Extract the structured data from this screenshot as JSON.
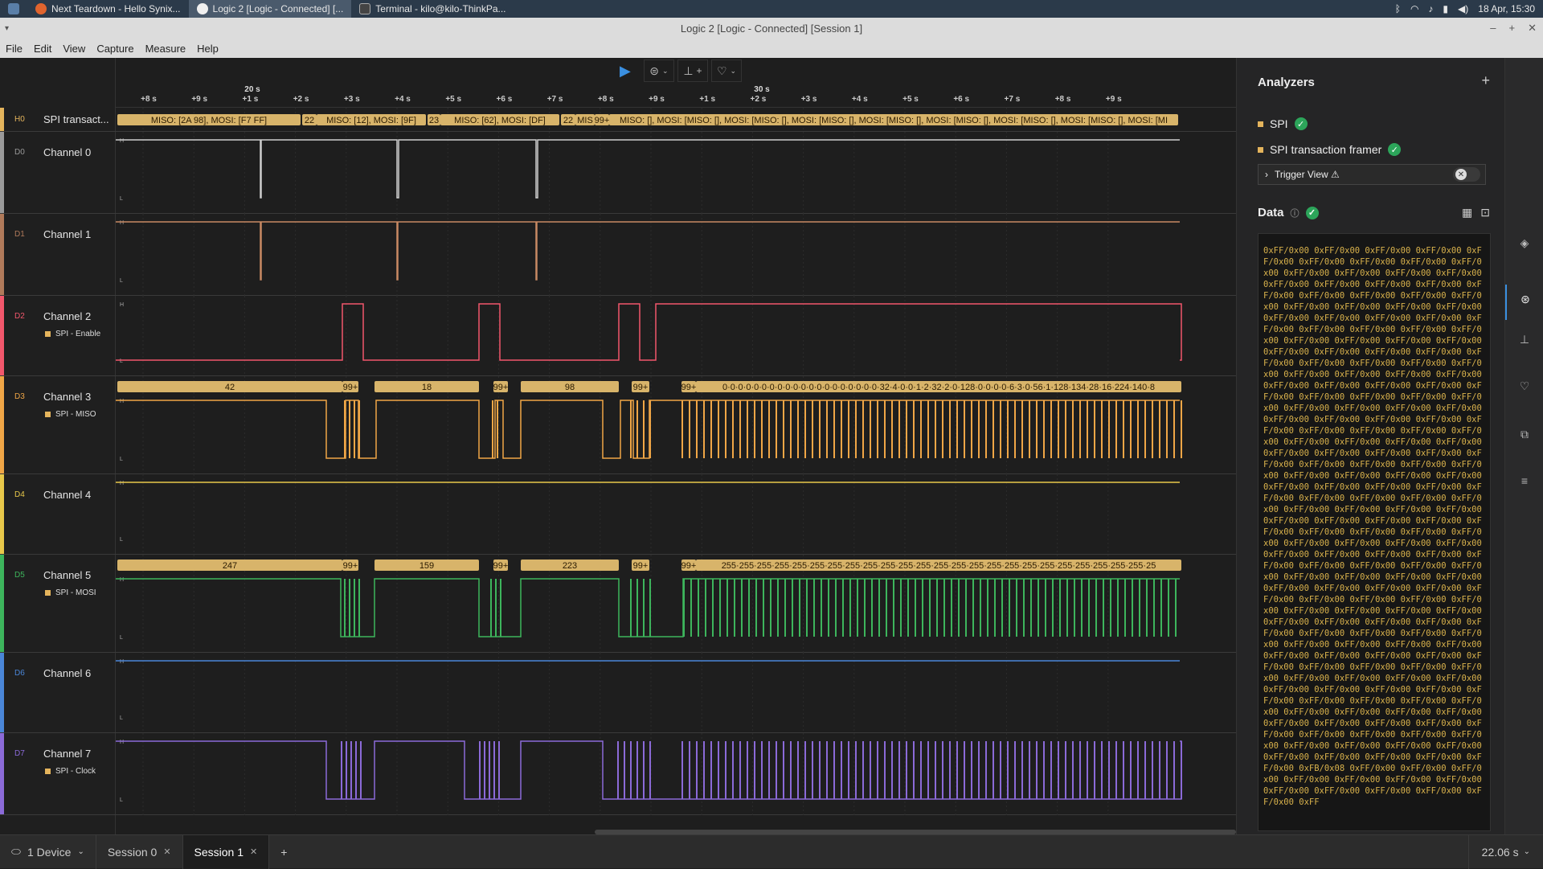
{
  "taskbar": {
    "tasks": [
      {
        "label": "Next Teardown - Hello Synix...",
        "color": "#e0642e"
      },
      {
        "label": "Logic 2 [Logic - Connected] [...",
        "color": "#f0f0f0"
      },
      {
        "label": "Terminal - kilo@kilo-ThinkPa...",
        "color": "#444444"
      }
    ],
    "clock": "18 Apr, 15:30"
  },
  "window": {
    "title": "Logic 2 [Logic - Connected] [Session 1]"
  },
  "menu": [
    "File",
    "Edit",
    "View",
    "Capture",
    "Measure",
    "Help"
  ],
  "ruler": {
    "ticks": [
      "+8 s",
      "+9 s",
      "+1 s",
      "+2 s",
      "+3 s",
      "+4 s",
      "+5 s",
      "+6 s",
      "+7 s",
      "+8 s",
      "+9 s",
      "+1 s",
      "+2 s",
      "+3 s",
      "+4 s",
      "+5 s",
      "+6 s",
      "+7 s",
      "+8 s",
      "+9 s"
    ],
    "majors": [
      "20 s",
      "30 s"
    ]
  },
  "channels": [
    {
      "id": "H0",
      "name": "SPI transact...",
      "color": "#e4b45c",
      "sub": ""
    },
    {
      "id": "D0",
      "name": "Channel 0",
      "color": "#9a9a9a",
      "sub": ""
    },
    {
      "id": "D1",
      "name": "Channel 1",
      "color": "#b07a5a",
      "sub": ""
    },
    {
      "id": "D2",
      "name": "Channel 2",
      "color": "#f2576c",
      "sub": "SPI - Enable"
    },
    {
      "id": "D3",
      "name": "Channel 3",
      "color": "#f0a646",
      "sub": "SPI - MISO"
    },
    {
      "id": "D4",
      "name": "Channel 4",
      "color": "#e8c84a",
      "sub": ""
    },
    {
      "id": "D5",
      "name": "Channel 5",
      "color": "#3db55c",
      "sub": "SPI - MOSI"
    },
    {
      "id": "D6",
      "name": "Channel 6",
      "color": "#4a86d8",
      "sub": ""
    },
    {
      "id": "D7",
      "name": "Channel 7",
      "color": "#8b6ad8",
      "sub": "SPI - Clock"
    }
  ],
  "transactions": [
    "MISO: [2A 98], MOSI: [F7 FF]",
    "22",
    "MISO: [12], MOSI: [9F]",
    "23",
    "MISO: [62], MOSI: [DF]",
    "22",
    "MIS",
    "99+",
    "MISO: [], MOSI: [MISO: [], MOSI: [MISO: [], MOSI: [MISO: [], MOSI: [MISO: [], MOSI: [MISO: [], MOSI: [MISO: [], MOSI: [MISO: [], MOSI: [MI"
  ],
  "miso_labels": [
    "42",
    "99+",
    "18",
    "99+",
    "98",
    "99+",
    "99+",
    "0·0·0·0·0·0·0·0·0·0·0·0·0·0·0·0·0·0·0·0·32·4·0·0·1·2·32·2·0·128·0·0·0·0·6·3·0·56·1·128·134·28·16·224·140·8"
  ],
  "mosi_labels": [
    "247",
    "99+",
    "159",
    "99+",
    "223",
    "99+",
    "99+",
    "255·255·255·255·255·255·255·255·255·255·255·255·255·255·255·255·255·255·255·255·255·255·255·255·25"
  ],
  "analyzers": {
    "title": "Analyzers",
    "items": [
      "SPI",
      "SPI transaction framer"
    ],
    "trigger_view": "Trigger View ⚠"
  },
  "data_panel": {
    "title": "Data",
    "terminal_text": "0xFF/0x00 0xFF/0x00 0xFF/0x00 0xFF/0x00 0xFF/0x00 0xFF/0x00 0xFF/0x00 0xFF/0x00 0xFF/0x00 0xFF/0x00 0xFF/0x00 0xFF/0x00 0xFF/0x00 0xFF/0x00 0xFF/0x00 0xFF/0x00 0xFF/0x00 0xFF/0x00 0xFF/0x00 0xFF/0x00 0xFF/0x00 0xFF/0x00 0xFF/0x00 0xFF/0x00 0xFF/0x00 0xFF/0x00 0xFF/0x00 0xFF/0x00 0xFF/0x00 0xFF/0x00 0xFF/0x00 0xFF/0x00 0xFF/0x00 0xFF/0x00 0xFF/0x00 0xFF/0x00 0xFF/0x00 0xFF/0x00 0xFF/0x00 0xFF/0x00 0xFF/0x00 0xFF/0x00 0xFF/0x00 0xFF/0x00 0xFF/0x00 0xFF/0x00 0xFF/0x00 0xFF/0x00 0xFF/0x00 0xFF/0x00 0xFF/0x00 0xFF/0x00 0xFF/0x00 0xFF/0x00 0xFF/0x00 0xFF/0x00 0xFF/0x00 0xFF/0x00 0xFF/0x00 0xFF/0x00 0xFF/0x00 0xFF/0x00 0xFF/0x00 0xFF/0x00 0xFF/0x00 0xFF/0x00 0xFF/0x00 0xFF/0x00 0xFF/0x00 0xFF/0x00 0xFF/0x00 0xFF/0x00 0xFF/0x00 0xFF/0x00 0xFF/0x00 0xFF/0x00 0xFF/0x00 0xFF/0x00 0xFF/0x00 0xFF/0x00 0xFF/0x00 0xFF/0x00 0xFF/0x00 0xFF/0x00 0xFF/0x00 0xFF/0x00 0xFF/0x00 0xFF/0x00 0xFF/0x00 0xFF/0x00 0xFF/0x00 0xFF/0x00 0xFF/0x00 0xFF/0x00 0xFF/0x00 0xFF/0x00 0xFF/0x00 0xFF/0x00 0xFF/0x00 0xFF/0x00 0xFF/0x00 0xFF/0x00 0xFF/0x00 0xFF/0x00 0xFF/0x00 0xFF/0x00 0xFF/0x00 0xFF/0x00 0xFF/0x00 0xFF/0x00 0xFF/0x00 0xFF/0x00 0xFF/0x00 0xFF/0x00 0xFF/0x00 0xFF/0x00 0xFF/0x00 0xFF/0x00 0xFF/0x00 0xFF/0x00 0xFF/0x00 0xFF/0x00 0xFF/0x00 0xFF/0x00 0xFF/0x00 0xFF/0x00 0xFF/0x00 0xFF/0x00 0xFF/0x00 0xFF/0x00 0xFF/0x00 0xFF/0x00 0xFF/0x00 0xFF/0x00 0xFF/0x00 0xFF/0x00 0xFF/0x00 0xFF/0x00 0xFF/0x00 0xFF/0x00 0xFF/0x00 0xFF/0x00 0xFF/0x00 0xFF/0x00 0xFF/0x00 0xFF/0x00 0xFF/0x00 0xFF/0x00 0xFF/0x00 0xFF/0x00 0xFF/0x00 0xFF/0x00 0xFF/0x00 0xFF/0x00 0xFF/0x00 0xFF/0x00 0xFF/0x00 0xFF/0x00 0xFF/0x00 0xFF/0x00 0xFF/0x00 0xFF/0x00 0xFF/0x00 0xFF/0x00 0xFF/0x00 0xFF/0x00 0xFF/0x00 0xFF/0x00 0xFF/0x00 0xFF/0x00 0xFF/0x00 0xFF/0x00 0xFF/0x00 0xFF/0x00 0xFF/0x00 0xFF/0x00 0xFF/0x00 0xFF/0x00 0xFF/0x00 0xFF/0x00 0xFF/0x00 0xFF/0x00 0xFF/0x00 0xFF/0x00 0xFF/0x00 0xFF/0x00 0xFF/0x00 0xFF/0x00 0xFF/0x00 0xFF/0x00 0xFF/0x00 0xFF/0x00 0xFF/0x00 0xFF/0x00 0xFF/0x00 0xFF/0x00 0xFF/0x00 0xFF/0x00 0xFF/0x00 0xFF/0x00 0xFB/0x08 0xFF/0x00 0xFF/0x00 0xFF/0x00 0xFF/0x00 0xFF/0x00 0xFF/0x00 0xFF/0x00 0xFF/0x00 0xFF/0x00 0xFF/0x00 0xFF/0x00 0xFF/0x00 0xFF"
  },
  "footer": {
    "device": "1 Device",
    "sessions": [
      "Session 0",
      "Session 1"
    ],
    "add": "+",
    "duration": "22.06 s"
  }
}
